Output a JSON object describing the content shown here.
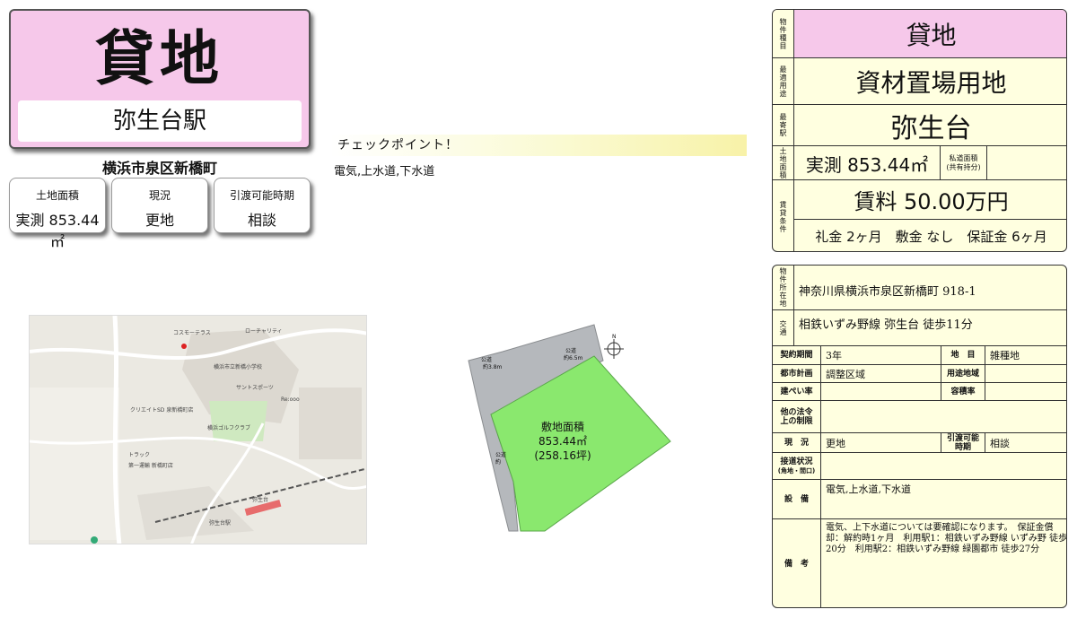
{
  "header": {
    "title": "貸地",
    "station": "弥生台駅",
    "address_short": "横浜市泉区新橋町"
  },
  "info_cards": [
    {
      "label": "土地面積",
      "value": "実測 853.44㎡"
    },
    {
      "label": "現況",
      "value": "更地"
    },
    {
      "label": "引渡可能時期",
      "value": "相談"
    }
  ],
  "checkpoint": {
    "heading": "チェックポイント！",
    "text": "電気,上水道,下水道"
  },
  "plot": {
    "area_label": "敷地面積",
    "area_sqm": "853.44㎡",
    "area_tsubo": "(258.16坪)",
    "road_labels": [
      "公道",
      "公道",
      "公道"
    ],
    "road_widths": [
      "約3.8m",
      "約6.5m",
      "約"
    ],
    "north_label": "N"
  },
  "map": {
    "labels": [
      "コスモーテラス",
      "ローチャリティ",
      "横浜市立新橋小学校",
      "サントスポーツ",
      "Re:ooo",
      "クリエイトSD 泉新橋町店",
      "横浜ゴルフクラブ",
      "トラック",
      "第一運輸 新橋町店",
      "弥生台",
      "弥生台駅"
    ]
  },
  "summary": {
    "type_label": "物件種目",
    "type_value": "貸地",
    "use_label": "最適用途",
    "use_value": "資材置場用地",
    "station_label": "最寄駅",
    "station_value": "弥生台",
    "area_label": "土地面積",
    "area_value": "実測 853.44㎡",
    "private_road_label": "私道面積",
    "private_road_sub": "(共有持分)",
    "rent_label": "賃貸条件",
    "rent_value": "賃料 50.00万円",
    "rent_terms": "礼金 2ヶ月　敷金 なし　保証金 6ヶ月"
  },
  "details": {
    "location_label": "物件所在地",
    "location_value": "神奈川県横浜市泉区新橋町 918-1",
    "transport_label": "交通",
    "transport_value": "相鉄いずみ野線 弥生台 徒歩11分",
    "contract_label": "契約期間",
    "contract_value": "3年",
    "land_category_label": "地　目",
    "land_category_value": "雑種地",
    "city_plan_label": "都市計画",
    "city_plan_value": "調整区域",
    "zoning_label": "用途地域",
    "zoning_value": "",
    "coverage_label": "建ぺい率",
    "coverage_value": "",
    "far_label": "容積率",
    "far_value": "",
    "other_law_label": "他の法令上の制限",
    "other_law_value": "",
    "status_label": "現　況",
    "status_value": "更地",
    "handover_label": "引渡可能時期",
    "handover_value": "相談",
    "road_label": "接道状況",
    "road_sub": "(角地・間口)",
    "road_value": "",
    "facilities_label": "設　備",
    "facilities_value": "電気,上水道,下水道",
    "remarks_label": "備　考",
    "remarks_value": "電気、上下水道については要確認になります。　保証金償却：解約時1ヶ月　利用駅1：相鉄いずみ野線 いずみ野 徒歩20分　利用駅2：相鉄いずみ野線 緑園都市 徒歩27分"
  }
}
